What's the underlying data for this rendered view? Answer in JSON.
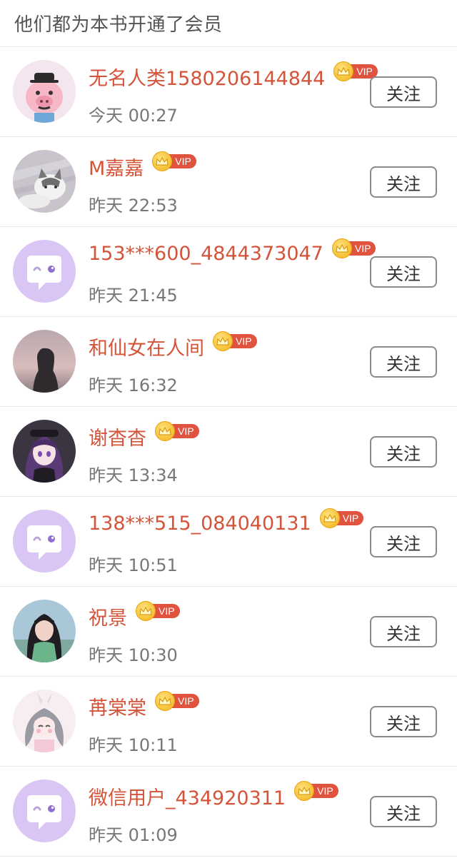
{
  "header": {
    "title": "他们都为本书开通了会员"
  },
  "vip_label": "VIP",
  "colors": {
    "name": "#d4543a",
    "vip_badge": "#e0533f",
    "crown": "#f2b21a",
    "default_avatar": "#d9c6f5"
  },
  "members": [
    {
      "name": "无名人类1580206144844",
      "time": "今天 00:27",
      "follow": "关注",
      "avatar": "pig-avatar"
    },
    {
      "name": "M嘉嘉",
      "time": "昨天 22:53",
      "follow": "关注",
      "avatar": "cat-avatar"
    },
    {
      "name": "153***600_4844373047",
      "time": "昨天 21:45",
      "follow": "关注",
      "avatar": "default-chat-avatar"
    },
    {
      "name": "和仙女在人间",
      "time": "昨天 16:32",
      "follow": "关注",
      "avatar": "silhouette-avatar"
    },
    {
      "name": "谢杳杳",
      "time": "昨天 13:34",
      "follow": "关注",
      "avatar": "anime-girl-avatar"
    },
    {
      "name": "138***515_084040131",
      "time": "昨天 10:51",
      "follow": "关注",
      "avatar": "default-chat-avatar"
    },
    {
      "name": "祝景",
      "time": "昨天 10:30",
      "follow": "关注",
      "avatar": "photo-girl-avatar"
    },
    {
      "name": "苒棠棠",
      "time": "昨天 10:11",
      "follow": "关注",
      "avatar": "bunny-girl-avatar"
    },
    {
      "name": "微信用户_434920311",
      "time": "昨天 01:09",
      "follow": "关注",
      "avatar": "default-chat-avatar"
    }
  ]
}
